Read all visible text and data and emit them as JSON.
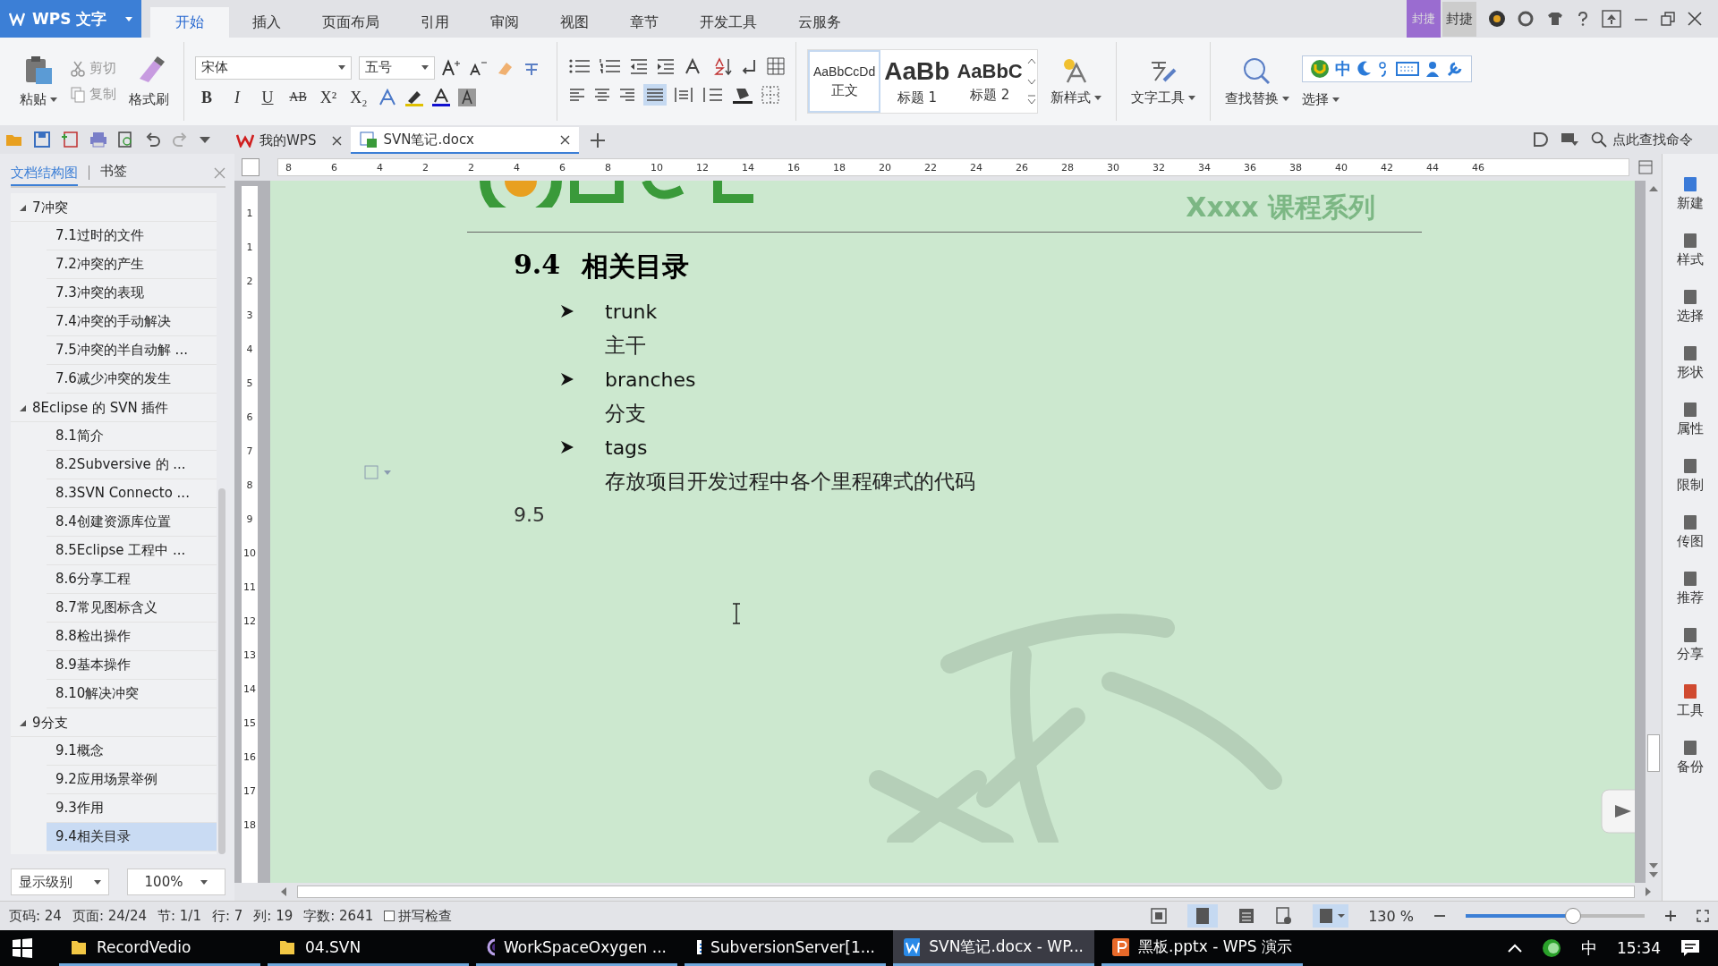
{
  "app": {
    "title": "WPS 文字"
  },
  "menu_tabs": [
    {
      "label": "开始",
      "selected": true
    },
    {
      "label": "插入",
      "selected": false
    },
    {
      "label": "页面布局",
      "selected": false
    },
    {
      "label": "引用",
      "selected": false
    },
    {
      "label": "审阅",
      "selected": false
    },
    {
      "label": "视图",
      "selected": false
    },
    {
      "label": "章节",
      "selected": false
    },
    {
      "label": "开发工具",
      "selected": false
    },
    {
      "label": "云服务",
      "selected": false
    }
  ],
  "account": {
    "badge": "封捷",
    "name": "封捷"
  },
  "ribbon": {
    "paste": "粘贴",
    "cut": {
      "label": "剪切",
      "disabled": true
    },
    "copy": {
      "label": "复制",
      "disabled": true
    },
    "format_painter": "格式刷",
    "font": "宋体",
    "font_size": "五号",
    "styles": [
      {
        "sample": "AaBbCcDd",
        "name": "正文",
        "selected": true
      },
      {
        "sample": "AaBb",
        "name": "标题 1",
        "selected": false
      },
      {
        "sample": "AaBbC",
        "name": "标题 2",
        "selected": false
      }
    ],
    "format_buttons": [
      "B",
      "I",
      "U",
      "AB",
      "X²",
      "X₂"
    ],
    "new_style": "新样式",
    "text_tools": "文字工具",
    "find_replace": "查找替换",
    "select": "选择",
    "ime": "中"
  },
  "doc_tabs": [
    {
      "label": "我的WPS",
      "selected": false
    },
    {
      "label": "SVN笔记.docx",
      "selected": true
    }
  ],
  "command_search": {
    "placeholder": "点此查找命令"
  },
  "nav_panel": {
    "tabs": [
      {
        "label": "文档结构图",
        "selected": true
      },
      {
        "label": "书签",
        "selected": false
      }
    ],
    "tree": [
      {
        "label": "7冲突",
        "expanded": true,
        "selected": false,
        "children": [
          {
            "label": "7.1过时的文件",
            "selected": false
          },
          {
            "label": "7.2冲突的产生",
            "selected": false
          },
          {
            "label": "7.3冲突的表现",
            "selected": false
          },
          {
            "label": "7.4冲突的手动解决",
            "selected": false
          },
          {
            "label": "7.5冲突的半自动解 ...",
            "selected": false
          },
          {
            "label": "7.6减少冲突的发生",
            "selected": false
          }
        ]
      },
      {
        "label": "8Eclipse 的 SVN 插件",
        "expanded": true,
        "selected": false,
        "children": [
          {
            "label": "8.1简介",
            "selected": false
          },
          {
            "label": "8.2Subversive 的 ...",
            "selected": false
          },
          {
            "label": "8.3SVN Connecto ...",
            "selected": false
          },
          {
            "label": "8.4创建资源库位置",
            "selected": false
          },
          {
            "label": "8.5Eclipse 工程中 ...",
            "selected": false
          },
          {
            "label": "8.6分享工程",
            "selected": false
          },
          {
            "label": "8.7常见图标含义",
            "selected": false
          },
          {
            "label": "8.8检出操作",
            "selected": false
          },
          {
            "label": "8.9基本操作",
            "selected": false
          },
          {
            "label": "8.10解决冲突",
            "selected": false
          }
        ]
      },
      {
        "label": "9分支",
        "expanded": true,
        "selected": false,
        "children": [
          {
            "label": "9.1概念",
            "selected": false
          },
          {
            "label": "9.2应用场景举例",
            "selected": false
          },
          {
            "label": "9.3作用",
            "selected": false
          },
          {
            "label": "9.4相关目录",
            "selected": true
          }
        ]
      }
    ],
    "level_select": "显示级别",
    "zoom_select": "100%"
  },
  "rulers": {
    "horizontal": [
      "8",
      "6",
      "4",
      "2",
      "2",
      "4",
      "6",
      "8",
      "10",
      "12",
      "14",
      "16",
      "18",
      "20",
      "22",
      "24",
      "26",
      "28",
      "30",
      "32",
      "34",
      "36",
      "38",
      "40",
      "42",
      "44",
      "46"
    ],
    "vertical": [
      "1",
      "1",
      "2",
      "3",
      "4",
      "5",
      "6",
      "7",
      "8",
      "9",
      "10",
      "11",
      "12",
      "13",
      "14",
      "15",
      "16",
      "17",
      "18"
    ]
  },
  "document": {
    "header": "Xxxx 课程系列",
    "heading_number": "9.4",
    "heading": "相关目录",
    "bullets": [
      {
        "term": "trunk",
        "desc": "主干"
      },
      {
        "term": "branches",
        "desc": "分支"
      },
      {
        "term": "tags",
        "desc": "存放项目开发过程中各个里程碑式的代码"
      }
    ],
    "next_heading": "9.5"
  },
  "right_sidebar": [
    "新建",
    "样式",
    "选择",
    "形状",
    "属性",
    "限制",
    "传图",
    "推荐",
    "分享",
    "工具",
    "备份"
  ],
  "status_bar": {
    "fields": [
      "页码: 24",
      "页面: 24/24",
      "节: 1/1",
      "行: 7",
      "列: 19",
      "字数: 2641"
    ],
    "spell_check": {
      "label": "拼写检查",
      "checked": false
    },
    "zoom": "130 %",
    "zoom_level": {
      "level": 0.6
    }
  },
  "taskbar": {
    "items": [
      {
        "label": "RecordVedio",
        "kind": "folder",
        "active": false
      },
      {
        "label": "04.SVN",
        "kind": "folder",
        "active": false
      },
      {
        "label": "WorkSpaceOxygen ...",
        "kind": "app",
        "active": false
      },
      {
        "label": "SubversionServer[1...",
        "kind": "server",
        "active": false
      },
      {
        "label": "SVN笔记.docx - WP...",
        "kind": "writer",
        "active": true
      },
      {
        "label": "黑板.pptx - WPS 演示",
        "kind": "slides",
        "active": false
      }
    ],
    "ime": "中",
    "time": "15:34"
  }
}
